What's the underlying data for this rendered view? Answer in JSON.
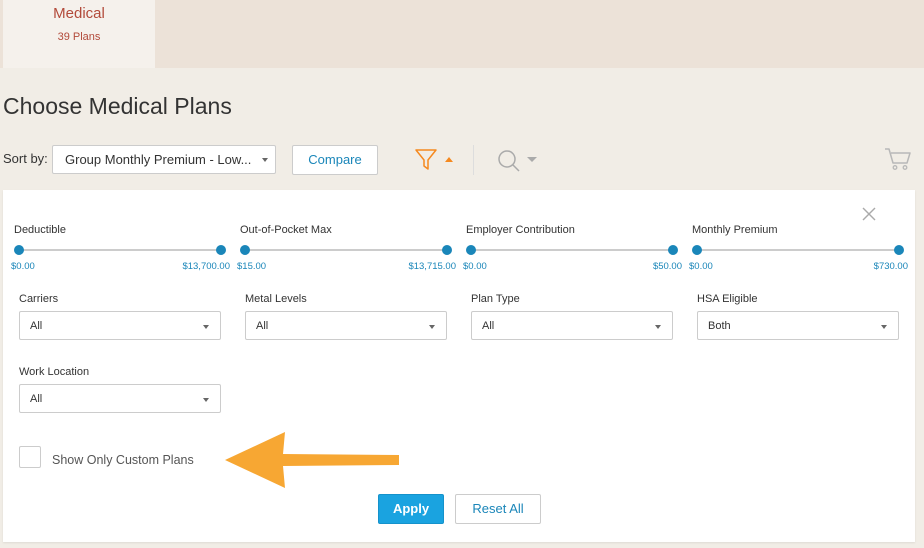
{
  "tab": {
    "title": "Medical",
    "subtitle": "39 Plans"
  },
  "page_title": "Choose Medical Plans",
  "toolbar": {
    "sort_label": "Sort by:",
    "sort_value": "Group Monthly Premium - Low...",
    "compare_label": "Compare"
  },
  "icons": [
    "filter-icon",
    "caret-up-icon",
    "search-icon",
    "caret-down-icon",
    "cart-icon",
    "close-icon",
    "arrow-left-icon"
  ],
  "colors": {
    "accent_blue": "#1a86b9",
    "apply_blue": "#1aa3e0",
    "filter_orange": "#f5891f",
    "arrow_orange": "#f7a733",
    "tab_red": "#b24a3a"
  },
  "sliders": [
    {
      "label": "Deductible",
      "min": "$0.00",
      "max": "$13,700.00"
    },
    {
      "label": "Out-of-Pocket Max",
      "min": "$15.00",
      "max": "$13,715.00"
    },
    {
      "label": "Employer Contribution",
      "min": "$0.00",
      "max": "$50.00"
    },
    {
      "label": "Monthly Premium",
      "min": "$0.00",
      "max": "$730.00"
    }
  ],
  "filters": [
    {
      "label": "Carriers",
      "value": "All"
    },
    {
      "label": "Metal Levels",
      "value": "All"
    },
    {
      "label": "Plan Type",
      "value": "All"
    },
    {
      "label": "HSA Eligible",
      "value": "Both"
    },
    {
      "label": "Work Location",
      "value": "All"
    }
  ],
  "custom_plans": {
    "label": "Show Only Custom Plans",
    "checked": false
  },
  "actions": {
    "apply": "Apply",
    "reset": "Reset All"
  }
}
